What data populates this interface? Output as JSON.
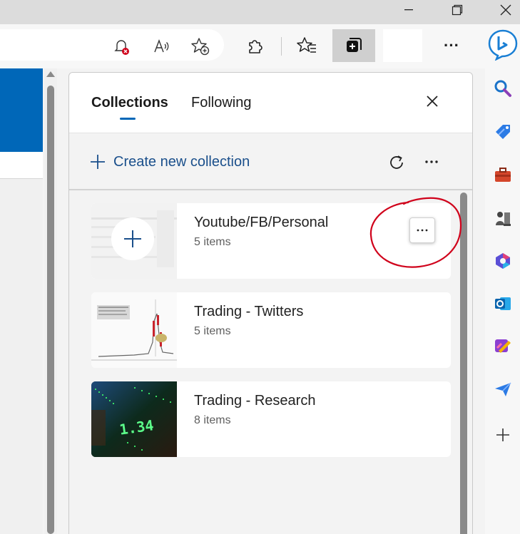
{
  "window": {
    "minimize_glyph": "—",
    "maximize_glyph": "❐",
    "close_glyph": "✕"
  },
  "toolbar": {
    "icons": [
      "tracking-prevention-icon",
      "read-aloud-icon",
      "add-favorite-icon",
      "extensions-icon",
      "favorites-icon",
      "collections-icon",
      "more-icon"
    ],
    "more_glyph": "···"
  },
  "panel": {
    "tabs": [
      {
        "label": "Collections",
        "active": true
      },
      {
        "label": "Following",
        "active": false
      }
    ],
    "create_label": "Create new collection",
    "accent_color": "#0067b8",
    "collections": [
      {
        "title": "Youtube/FB/Personal",
        "count": "5 items"
      },
      {
        "title": "Trading - Twitters",
        "count": "5 items"
      },
      {
        "title": "Trading - Research",
        "count": "8 items"
      }
    ],
    "item_more_glyph": "···"
  },
  "sidebar": {
    "icons": [
      "search-icon",
      "shopping-tag-icon",
      "toolbox-icon",
      "games-icon",
      "office-icon",
      "outlook-icon",
      "designer-icon",
      "send-icon",
      "add-icon"
    ]
  },
  "annotation": {
    "color": "#d0021b"
  }
}
